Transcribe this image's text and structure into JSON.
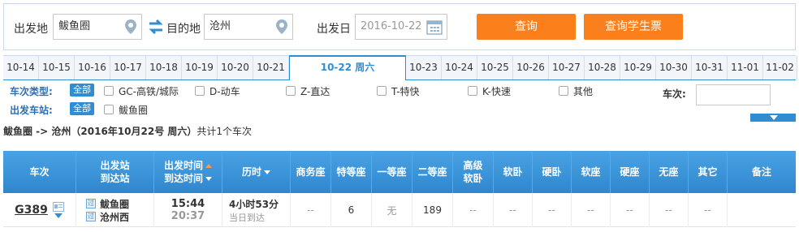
{
  "search": {
    "from_label": "出发地",
    "from_value": "鲅鱼圈",
    "to_label": "目的地",
    "to_value": "沧州",
    "date_label": "出发日",
    "date_placeholder": "2016-10-22",
    "query_button": "查询",
    "student_button": "查询学生票"
  },
  "date_tabs": [
    "10-14",
    "10-15",
    "10-16",
    "10-17",
    "10-18",
    "10-19",
    "10-20",
    "10-21",
    "10-22 周六",
    "10-23",
    "10-24",
    "10-25",
    "10-26",
    "10-27",
    "10-28",
    "10-29",
    "10-30",
    "10-31",
    "11-01",
    "11-02"
  ],
  "active_date_index": 8,
  "filter": {
    "type_label": "车次类型:",
    "all_label": "全部",
    "types": [
      "GC-高铁/城际",
      "D-动车",
      "Z-直达",
      "T-特快",
      "K-快速",
      "其他"
    ],
    "station_label": "出发车站:",
    "stations": [
      "鲅鱼圈"
    ],
    "train_no_label": "车次:"
  },
  "summary": {
    "route": "鲅鱼圈 -> 沧州（2016年10月22号  周六）",
    "count_text": "共计1个车次"
  },
  "table": {
    "headers": {
      "train": "车次",
      "station_1": "出发站",
      "station_2": "到达站",
      "time_1": "出发时间",
      "time_2": "到达时间",
      "duration": "历时",
      "business": "商务座",
      "special": "特等座",
      "first": "一等座",
      "second": "二等座",
      "soft_sleeper_high_1": "高级",
      "soft_sleeper_high_2": "软卧",
      "soft_sleeper": "软卧",
      "hard_sleeper": "硬卧",
      "soft_seat": "软座",
      "hard_seat": "硬座",
      "no_seat": "无座",
      "other": "其它",
      "remark": "备注"
    },
    "rows": [
      {
        "train": "G389",
        "from_tag": "过",
        "from_station": "鲅鱼圈",
        "to_tag": "过",
        "to_station": "沧州西",
        "depart": "15:44",
        "arrive": "20:37",
        "duration": "4小时53分",
        "arrive_day": "当日到达",
        "business": "--",
        "special": "6",
        "first": "无",
        "second": "189",
        "soft_sleeper_high": "--",
        "soft_sleeper": "--",
        "hard_sleeper": "--",
        "soft_seat": "--",
        "hard_seat": "--",
        "no_seat": "--",
        "other": "--",
        "remark": ""
      }
    ]
  },
  "colors": {
    "accent": "#2f8dd4",
    "orange": "#fb7f1b"
  }
}
